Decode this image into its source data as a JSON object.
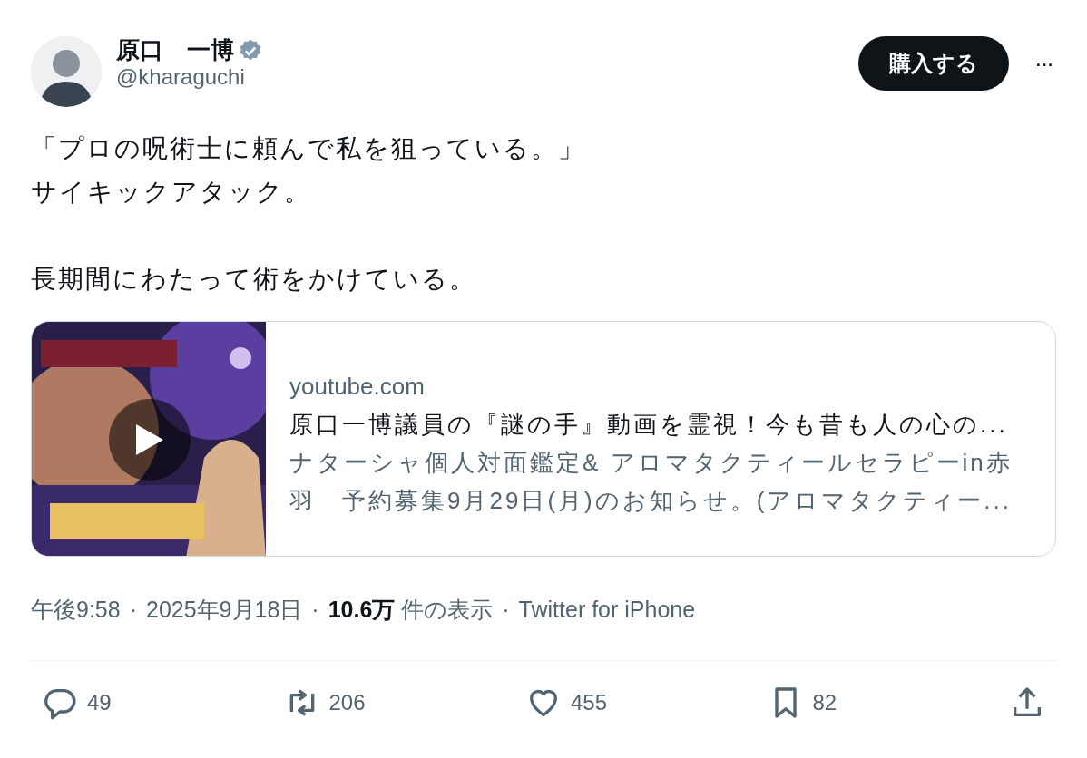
{
  "author": {
    "name": "原口　一博",
    "verified": true,
    "handle": "@kharaguchi"
  },
  "buy_button": "購入する",
  "more_button": "···",
  "tweet_paragraphs": [
    [
      "「プロの呪術士に頼んで私を狙っている。」",
      "サイキックアタック。"
    ],
    [
      "長期間にわたって術をかけている。"
    ]
  ],
  "link_card": {
    "thumbnail": {
      "kind": "picture",
      "video": true
    },
    "domain": "youtube.com",
    "title": "原口一博議員の『謎の手』動画を霊視！今も昔も人の心の...",
    "description": "ナターシャ個人対面鑑定& アロマタクティールセラピーin赤羽　予約募集9月29日(月)のお知らせ。(アロマタクティー..."
  },
  "meta": [
    {
      "kind": "time",
      "text": "午後9:58"
    },
    {
      "kind": "separator",
      "text": "·"
    },
    {
      "kind": "date",
      "text": "2025年9月18日"
    },
    {
      "kind": "separator",
      "text": "·"
    },
    {
      "kind": "views",
      "text": "**10.6万** 件の表示"
    },
    {
      "kind": "separator",
      "text": "·"
    },
    {
      "kind": "source",
      "text": "Twitter for iPhone"
    }
  ],
  "actions": [
    {
      "kind": "reply",
      "count": "49"
    },
    {
      "kind": "retweet",
      "count": "206"
    },
    {
      "kind": "like",
      "count": "455"
    },
    {
      "kind": "bookmark",
      "count": "82"
    },
    {
      "kind": "share"
    }
  ]
}
